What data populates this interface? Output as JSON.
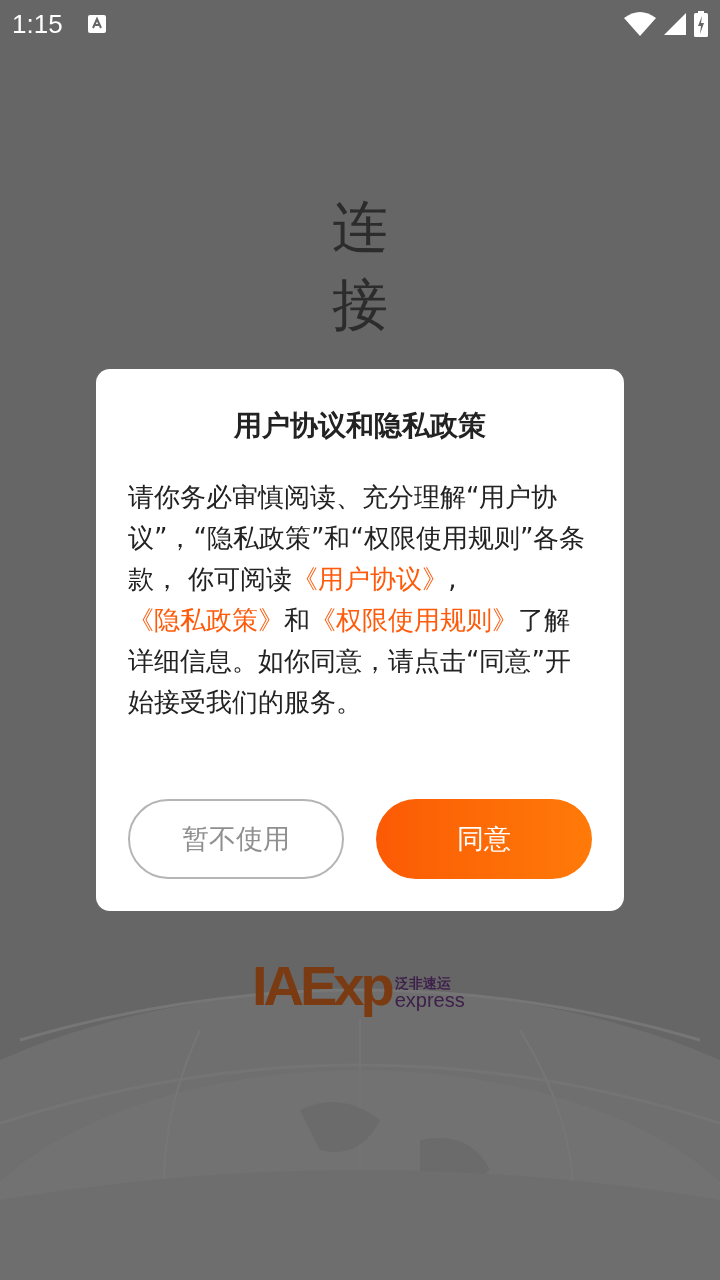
{
  "status_bar": {
    "time": "1:15"
  },
  "background": {
    "vertical_title": "连接",
    "logo": {
      "mark": "IAExp",
      "chinese_name": "泛非速运",
      "english_name": "express"
    }
  },
  "dialog": {
    "title": "用户协议和隐私政策",
    "body": [
      {
        "kind": "text",
        "text": "请你务必审慎阅读、充分理解“用户协议”，“隐私政策”和“权限使用规则”各条款， 你可阅读"
      },
      {
        "kind": "link",
        "text": "《用户协议》"
      },
      {
        "kind": "text",
        "text": ","
      },
      {
        "kind": "link",
        "text": "《隐私政策》"
      },
      {
        "kind": "text",
        "text": "和"
      },
      {
        "kind": "link",
        "text": "《权限使用规则》"
      },
      {
        "kind": "text",
        "text": "了解详细信息。如你同意，请点击“同意”开始接受我们的服务。"
      }
    ],
    "buttons": [
      {
        "label": "暂不使用",
        "kind": "secondary"
      },
      {
        "label": "同意",
        "kind": "primary"
      }
    ]
  }
}
